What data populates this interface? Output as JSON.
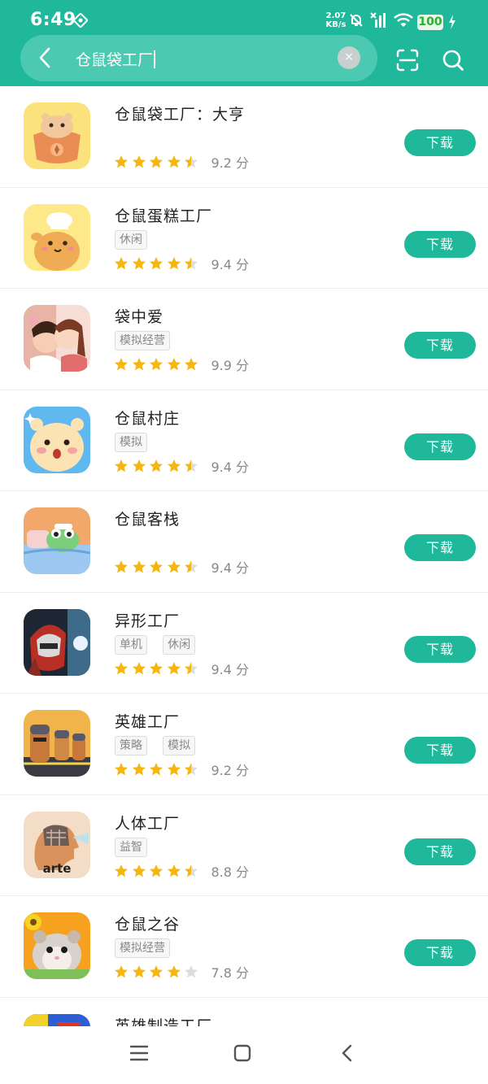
{
  "status": {
    "time": "6:49",
    "net_speed_value": "2.07",
    "net_speed_unit": "KB/s",
    "battery": "100",
    "icons": [
      "notification-app-icon",
      "bell-muted-icon",
      "no-signal-icon",
      "wifi-icon",
      "charging-bolt-icon"
    ]
  },
  "search": {
    "query": "仓鼠袋工厂",
    "clear_label": "×",
    "icons": [
      "back-arrow-icon",
      "scan-icon",
      "search-icon"
    ]
  },
  "colors": {
    "brand": "#1fb89b",
    "star": "#f5b70f",
    "star_empty": "#dddddd"
  },
  "apps": [
    {
      "name": "仓鼠袋工厂：大亨",
      "tags": [],
      "rating": 4.5,
      "score": "9.2 分",
      "button": "下载",
      "icon": "hamster-bag-icon"
    },
    {
      "name": "仓鼠蛋糕工厂",
      "tags": [
        "休闲"
      ],
      "rating": 4.5,
      "score": "9.4 分",
      "button": "下载",
      "icon": "hamster-chef-icon"
    },
    {
      "name": "袋中爱",
      "tags": [
        "模拟经营"
      ],
      "rating": 5,
      "score": "9.9 分",
      "button": "下载",
      "icon": "couple-kiss-icon"
    },
    {
      "name": "仓鼠村庄",
      "tags": [
        "模拟"
      ],
      "rating": 4.5,
      "score": "9.4 分",
      "button": "下载",
      "icon": "hamster-face-icon"
    },
    {
      "name": "仓鼠客栈",
      "tags": [],
      "rating": 4.5,
      "score": "9.4 分",
      "button": "下载",
      "icon": "frog-in-bed-icon"
    },
    {
      "name": "异形工厂",
      "tags": [
        "单机",
        "休闲"
      ],
      "rating": 4.5,
      "score": "9.4 分",
      "button": "下载",
      "icon": "robot-helmet-icon"
    },
    {
      "name": "英雄工厂",
      "tags": [
        "策略",
        "模拟"
      ],
      "rating": 4.5,
      "score": "9.2 分",
      "button": "下载",
      "icon": "hero-soldiers-icon"
    },
    {
      "name": "人体工厂",
      "tags": [
        "益智"
      ],
      "rating": 4.5,
      "score": "8.8 分",
      "button": "下载",
      "icon": "human-head-arte-icon",
      "icon_text": "arte"
    },
    {
      "name": "仓鼠之谷",
      "tags": [
        "模拟经营"
      ],
      "rating": 4,
      "score": "7.8 分",
      "button": "下载",
      "icon": "hamster-sunflower-icon"
    },
    {
      "name": "英雄制造工厂",
      "tags": [],
      "rating": 0,
      "score": "",
      "button": "",
      "icon": "hero-maker-icon"
    }
  ],
  "nav": {
    "icons": [
      "menu-icon",
      "home-square-icon",
      "back-icon"
    ]
  }
}
